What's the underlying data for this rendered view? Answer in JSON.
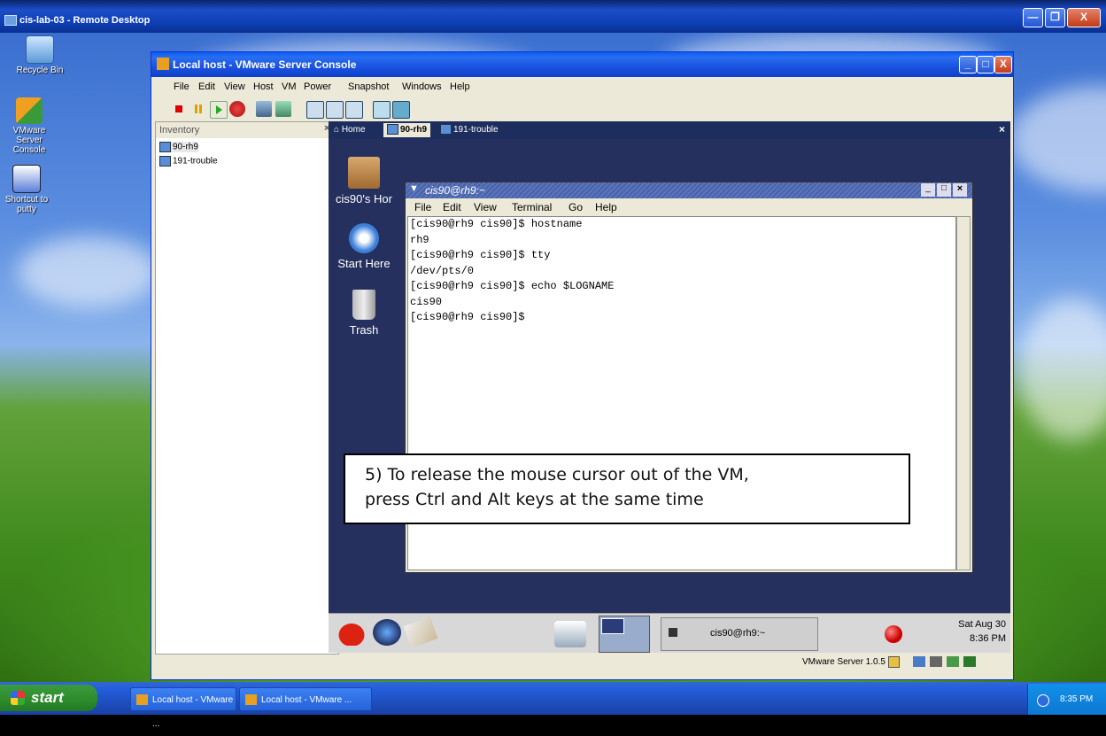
{
  "remote_desktop": {
    "title": "cis-lab-03 - Remote Desktop",
    "buttons": {
      "minimize": "—",
      "restore": "❐",
      "close": "X"
    }
  },
  "desktop_icons": [
    {
      "label": "Recycle Bin"
    },
    {
      "label": "VMware Server Console"
    },
    {
      "label": "Shortcut to putty"
    }
  ],
  "vmware": {
    "title": "Local host - VMware Server Console",
    "menu": [
      "File",
      "Edit",
      "View",
      "Host",
      "VM",
      "Power",
      "Snapshot",
      "Windows",
      "Help"
    ],
    "inventory": {
      "header": "Inventory",
      "close": "×",
      "items": [
        "90-rh9",
        "191-trouble"
      ]
    },
    "tabs": [
      "Home",
      "90-rh9",
      "191-trouble"
    ],
    "tabs_close": "×",
    "status": "VMware Server 1.0.5"
  },
  "guest": {
    "icons": [
      "cis90's Hor",
      "Start Here",
      "Trash"
    ],
    "terminal": {
      "title": "cis90@rh9:~",
      "menu": [
        "File",
        "Edit",
        "View",
        "Terminal",
        "Go",
        "Help"
      ],
      "lines": [
        "[cis90@rh9 cis90]$ hostname",
        "rh9",
        "[cis90@rh9 cis90]$ tty",
        "/dev/pts/0",
        "[cis90@rh9 cis90]$ echo $LOGNAME",
        "cis90",
        "[cis90@rh9 cis90]$"
      ]
    },
    "panel": {
      "task_label": "cis90@rh9:~",
      "clock_date": "Sat Aug 30",
      "clock_time": "8:36 PM"
    }
  },
  "callout": {
    "line1": "5) To release the mouse cursor out of the VM,",
    "line2": "press Ctrl and Alt keys at the same time"
  },
  "taskbar": {
    "start": "start",
    "tasks": [
      "Local host - VMware ...",
      "Local host - VMware ..."
    ],
    "clock": "8:35 PM"
  }
}
